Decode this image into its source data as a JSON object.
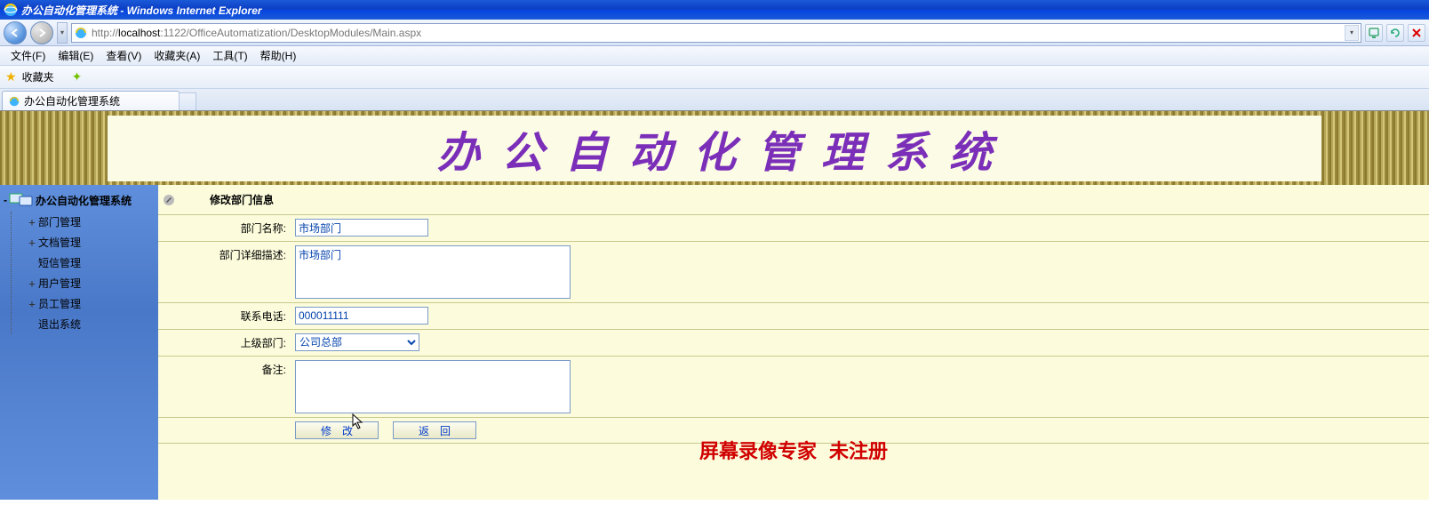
{
  "window": {
    "title": "办公自动化管理系统 - Windows Internet Explorer"
  },
  "url": {
    "prefix": "http://",
    "host": "localhost",
    "path": ":1122/OfficeAutomatization/DesktopModules/Main.aspx"
  },
  "menu": {
    "file": "文件(F)",
    "edit": "编辑(E)",
    "view": "查看(V)",
    "favorites": "收藏夹(A)",
    "tools": "工具(T)",
    "help": "帮助(H)"
  },
  "favbar": {
    "label": "收藏夹"
  },
  "tab": {
    "title": "办公自动化管理系统"
  },
  "banner": {
    "title": "办公自动化管理系统"
  },
  "sidebar": {
    "root": "办公自动化管理系统",
    "items": [
      {
        "label": "部门管理",
        "exp": "+"
      },
      {
        "label": "文档管理",
        "exp": "+"
      },
      {
        "label": "短信管理",
        "exp": ""
      },
      {
        "label": "用户管理",
        "exp": "+"
      },
      {
        "label": "员工管理",
        "exp": "+"
      },
      {
        "label": "退出系统",
        "exp": ""
      }
    ]
  },
  "form": {
    "header": "修改部门信息",
    "labels": {
      "name": "部门名称:",
      "desc": "部门详细描述:",
      "phone": "联系电话:",
      "parent": "上级部门:",
      "remark": "备注:"
    },
    "values": {
      "name": "市场部门",
      "desc": "市场部门",
      "phone": "000011111",
      "parent": "公司总部",
      "remark": ""
    },
    "buttons": {
      "modify": "修改",
      "back": "返回"
    }
  },
  "watermark": {
    "a": "屏幕录像专家",
    "b": "未注册"
  }
}
